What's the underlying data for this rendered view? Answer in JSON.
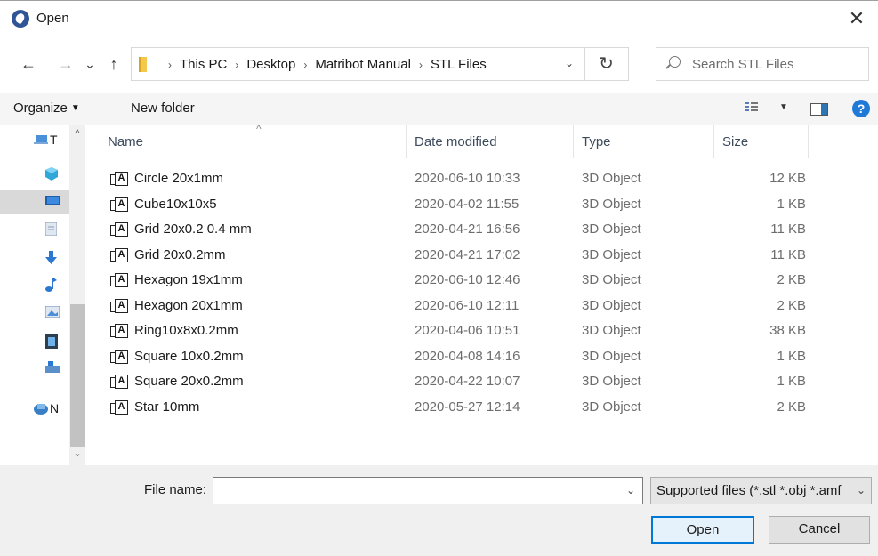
{
  "window": {
    "title": "Open",
    "close_glyph": "✕"
  },
  "nav": {
    "back_glyph": "←",
    "forward_glyph": "→",
    "recent_glyph": "⌄",
    "up_glyph": "↑",
    "breadcrumb": [
      "This PC",
      "Desktop",
      "Matribot Manual",
      "STL Files"
    ],
    "crumb_separator": "›",
    "refresh_glyph": "↻",
    "search_placeholder": "Search STL Files"
  },
  "toolbar": {
    "organize_label": "Organize",
    "new_folder_label": "New folder",
    "help_glyph": "?"
  },
  "navpane": {
    "items": [
      {
        "icon": "this-pc-icon",
        "label": "T",
        "selected": false
      },
      {
        "icon": "3d-objects-icon",
        "label": "",
        "selected": false
      },
      {
        "icon": "desktop-icon",
        "label": "",
        "selected": true
      },
      {
        "icon": "documents-icon",
        "label": "",
        "selected": false
      },
      {
        "icon": "downloads-icon",
        "label": "",
        "selected": false
      },
      {
        "icon": "music-icon",
        "label": "",
        "selected": false
      },
      {
        "icon": "pictures-icon",
        "label": "",
        "selected": false
      },
      {
        "icon": "videos-icon",
        "label": "",
        "selected": false
      },
      {
        "icon": "drive-icon",
        "label": "",
        "selected": false
      },
      {
        "icon": "network-icon",
        "label": "N",
        "selected": false
      }
    ]
  },
  "columns": {
    "name": "Name",
    "date": "Date modified",
    "type": "Type",
    "size": "Size"
  },
  "files": [
    {
      "name": "Circle 20x1mm",
      "date": "2020-06-10 10:33",
      "type": "3D Object",
      "size": "12 KB"
    },
    {
      "name": "Cube10x10x5",
      "date": "2020-04-02 11:55",
      "type": "3D Object",
      "size": "1 KB"
    },
    {
      "name": "Grid 20x0.2 0.4 mm",
      "date": "2020-04-21 16:56",
      "type": "3D Object",
      "size": "11 KB"
    },
    {
      "name": "Grid 20x0.2mm",
      "date": "2020-04-21 17:02",
      "type": "3D Object",
      "size": "11 KB"
    },
    {
      "name": "Hexagon 19x1mm",
      "date": "2020-06-10 12:46",
      "type": "3D Object",
      "size": "2 KB"
    },
    {
      "name": "Hexagon 20x1mm",
      "date": "2020-06-10 12:11",
      "type": "3D Object",
      "size": "2 KB"
    },
    {
      "name": "Ring10x8x0.2mm",
      "date": "2020-04-06 10:51",
      "type": "3D Object",
      "size": "38 KB"
    },
    {
      "name": "Square 10x0.2mm",
      "date": "2020-04-08 14:16",
      "type": "3D Object",
      "size": "1 KB"
    },
    {
      "name": "Square 20x0.2mm",
      "date": "2020-04-22 10:07",
      "type": "3D Object",
      "size": "1 KB"
    },
    {
      "name": "Star 10mm",
      "date": "2020-05-27 12:14",
      "type": "3D Object",
      "size": "2 KB"
    }
  ],
  "file_icon_letter": "A",
  "footer": {
    "filename_label": "File name:",
    "filename_value": "",
    "filetype_value": "Supported files (*.stl *.obj *.amf",
    "open_label": "Open",
    "cancel_label": "Cancel"
  }
}
